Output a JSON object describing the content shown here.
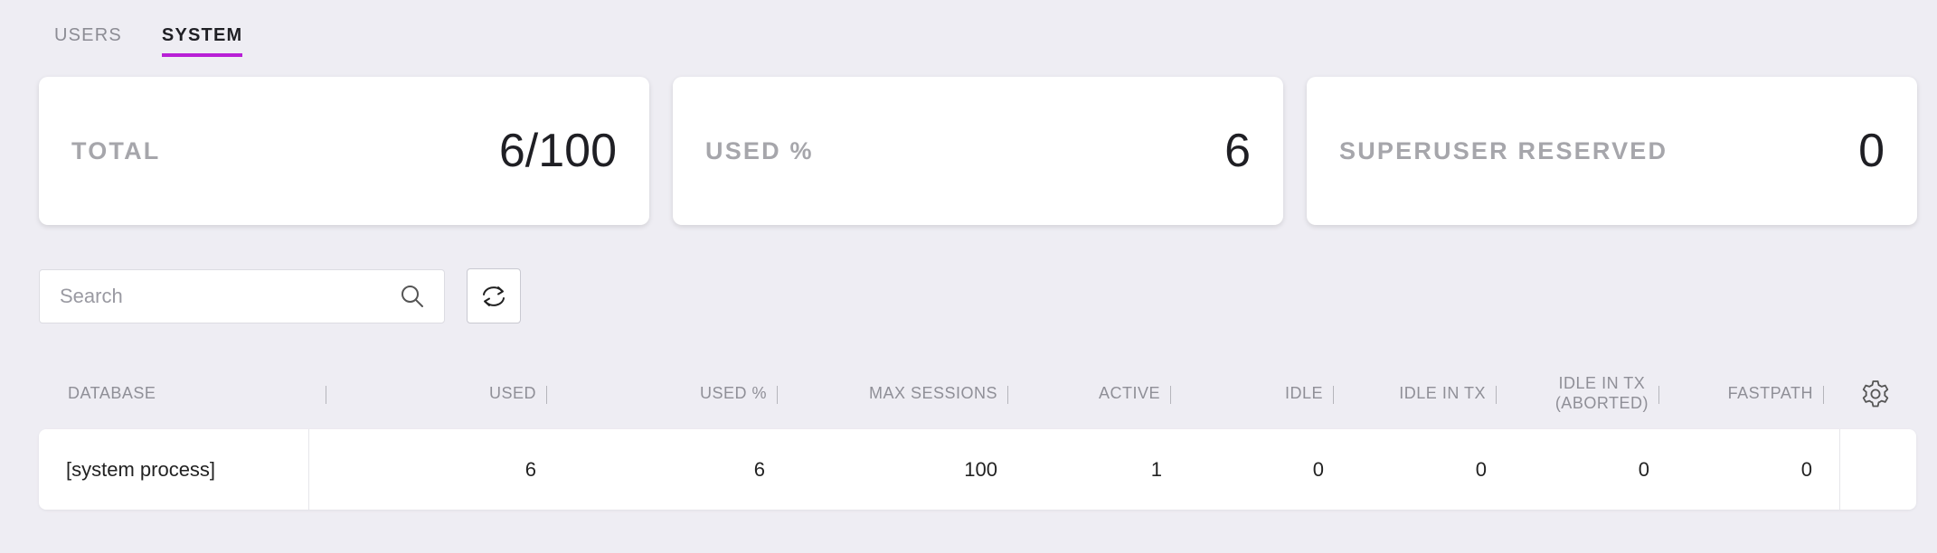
{
  "tabs": [
    {
      "label": "USERS",
      "active": false
    },
    {
      "label": "SYSTEM",
      "active": true
    }
  ],
  "accent_color": "#b81fd6",
  "cards": [
    {
      "label": "TOTAL",
      "value": "6/100"
    },
    {
      "label": "USED %",
      "value": "6"
    },
    {
      "label": "SUPERUSER RESERVED",
      "value": "0"
    }
  ],
  "search": {
    "placeholder": "Search",
    "value": "",
    "icon": "search-icon"
  },
  "refresh": {
    "icon": "refresh-icon"
  },
  "table": {
    "columns": [
      "DATABASE",
      "USED",
      "USED %",
      "MAX SESSIONS",
      "ACTIVE",
      "IDLE",
      "IDLE IN TX",
      "IDLE IN TX\n(ABORTED)",
      "FASTPATH"
    ],
    "settings_icon": "gear-icon",
    "rows": [
      [
        "[system process]",
        "6",
        "6",
        "100",
        "1",
        "0",
        "0",
        "0",
        "0"
      ]
    ]
  }
}
